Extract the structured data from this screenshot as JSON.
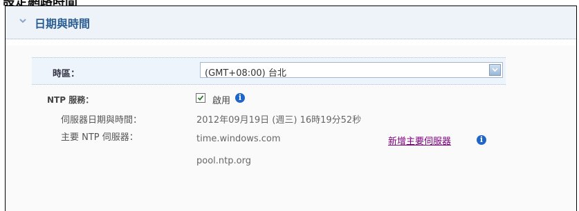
{
  "page_header_partial": "設定網路時間",
  "panel": {
    "title": "日期與時間"
  },
  "timezone": {
    "label": "時區：",
    "selected": "(GMT+08:00) 台北"
  },
  "ntp": {
    "label": "NTP 服務：",
    "enable_label": "啟用",
    "enabled": true,
    "server_time_label": "伺服器日期與時間：",
    "server_time_value": "2012年09月19日 (週三) 16時19分52秒",
    "primary_label": "主要 NTP 伺服器：",
    "servers": [
      "time.windows.com",
      "pool.ntp.org"
    ],
    "add_link": "新增主要伺服器"
  },
  "icons": {
    "collapse": "chevron-down-icon",
    "info": "info-icon",
    "dropdown": "dropdown-arrow-icon",
    "checkbox": "checkmark-icon"
  },
  "colors": {
    "title": "#2a5e93",
    "link": "#800080",
    "info": "#1f66c8"
  }
}
